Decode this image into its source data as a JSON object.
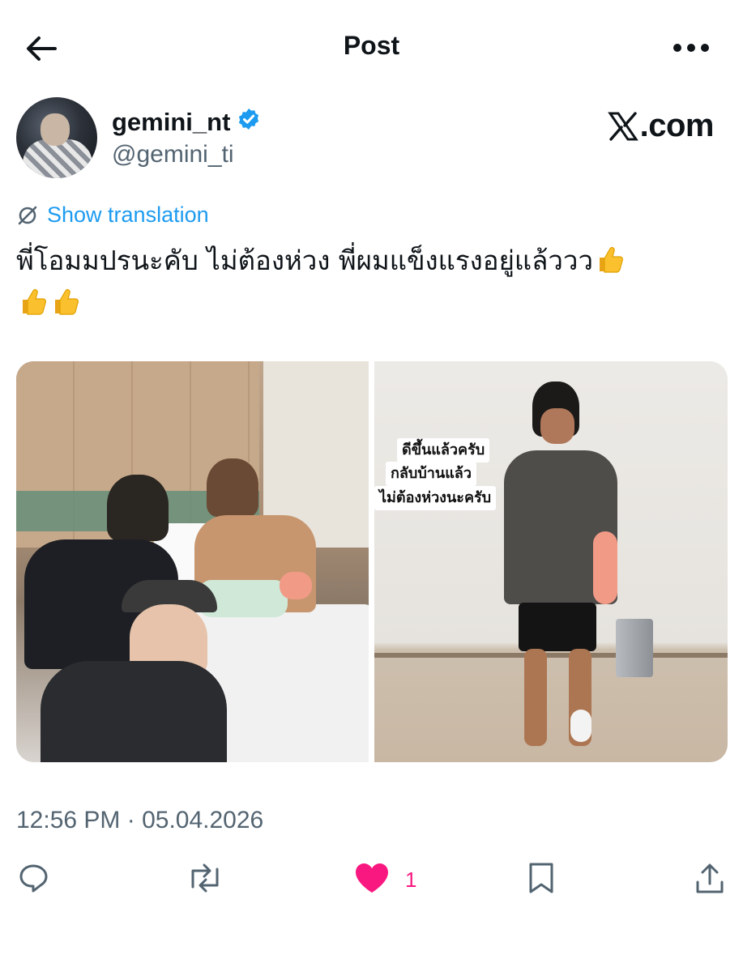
{
  "header": {
    "title": "Post"
  },
  "author": {
    "display_name": "gemini_nt",
    "handle": "@gemini_ti",
    "verified": true
  },
  "watermark": "X.com",
  "translation": {
    "label": "Show translation"
  },
  "post": {
    "text_line1": "พี่โอมมปรนะคับ ไม่ต้องห่วง พี่ผมแข็งแรงอยู่แล้ววว",
    "emoji": "thumbs-up",
    "caption_lines": [
      "ดีขึ้นแล้วครับ",
      "กลับบ้านแล้ว",
      "ไม่ต้องห่วงนะครับ"
    ]
  },
  "timestamp": "12:56 PM · 05.04.2026",
  "actions": {
    "reply_icon": "reply-icon",
    "repost_icon": "repost-icon",
    "like_icon": "heart-filled-icon",
    "like_count": "1",
    "bookmark_icon": "bookmark-icon",
    "share_icon": "share-icon"
  },
  "colors": {
    "accent": "#1d9bf0",
    "like": "#f91880",
    "muted": "#536471",
    "verified": "#1d9bf0"
  }
}
